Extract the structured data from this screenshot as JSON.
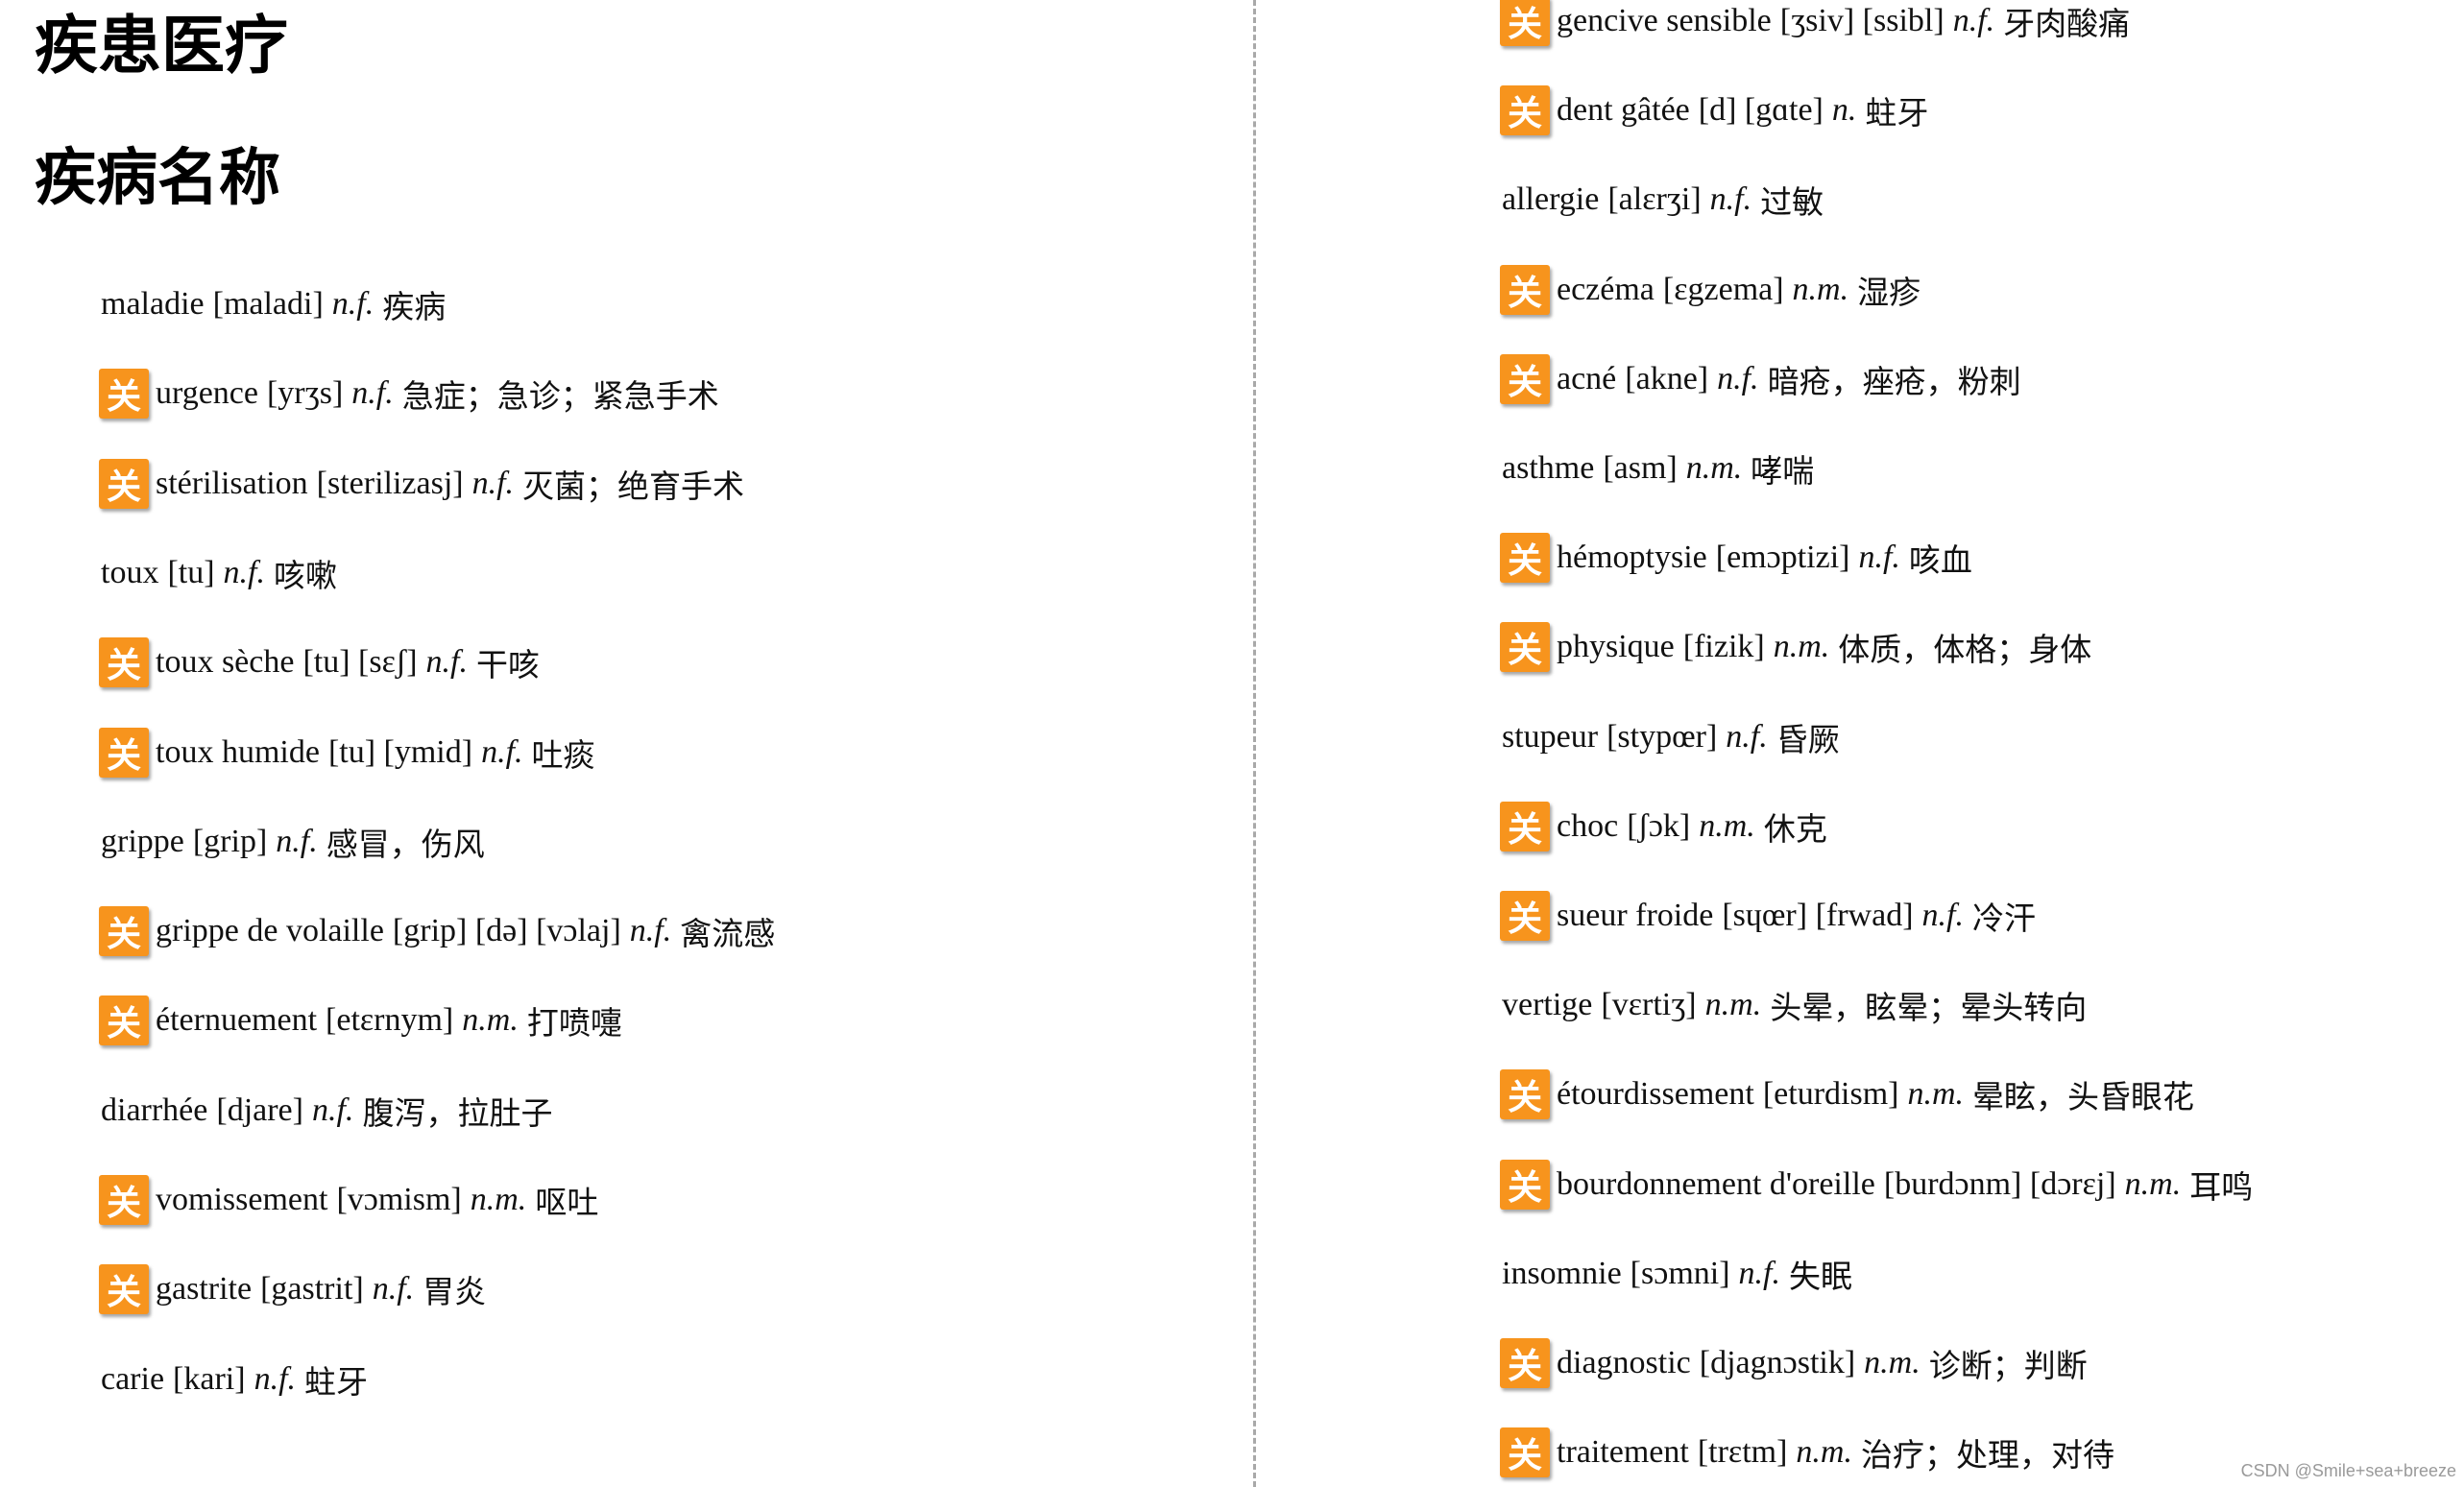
{
  "title": "疾患医疗",
  "section_title": "疾病名称",
  "badge_char": "关",
  "badge_color": "#f7941d",
  "watermark": "CSDN @Smile+sea+breeze",
  "left_entries": [
    {
      "word": "maladie",
      "ipa": "[maladi]",
      "pos": "n.f.",
      "zh": "疾病",
      "badge": false
    },
    {
      "word": "urgence",
      "ipa": "[yrʒs]",
      "pos": "n.f.",
      "zh": "急症；急诊；紧急手术",
      "badge": true
    },
    {
      "word": "stérilisation",
      "ipa": "[sterilizasj]",
      "pos": "n.f.",
      "zh": "灭菌；绝育手术",
      "badge": true
    },
    {
      "word": "toux",
      "ipa": "[tu]",
      "pos": "n.f.",
      "zh": "咳嗽",
      "badge": false
    },
    {
      "word": "toux sèche",
      "ipa": "[tu] [sɛʃ]",
      "pos": "n.f.",
      "zh": "干咳",
      "badge": true
    },
    {
      "word": "toux humide",
      "ipa": "[tu] [ymid]",
      "pos": "n.f.",
      "zh": "吐痰",
      "badge": true
    },
    {
      "word": "grippe",
      "ipa": "[grip]",
      "pos": "n.f.",
      "zh": "感冒，伤风",
      "badge": false
    },
    {
      "word": "grippe de volaille",
      "ipa": "[grip] [də] [vɔlaj]",
      "pos": "n.f.",
      "zh": "禽流感",
      "badge": true
    },
    {
      "word": "éternuement",
      "ipa": "[etɛrnym]",
      "pos": "n.m.",
      "zh": "打喷嚏",
      "badge": true
    },
    {
      "word": "diarrhée",
      "ipa": "[djare]",
      "pos": "n.f.",
      "zh": "腹泻，拉肚子",
      "badge": false
    },
    {
      "word": "vomissement",
      "ipa": "[vɔmism]",
      "pos": "n.m.",
      "zh": "呕吐",
      "badge": true
    },
    {
      "word": "gastrite",
      "ipa": "[gastrit]",
      "pos": "n.f.",
      "zh": "胃炎",
      "badge": true
    },
    {
      "word": "carie",
      "ipa": "[kari]",
      "pos": "n.f.",
      "zh": "蛀牙",
      "badge": false
    }
  ],
  "right_entries": [
    {
      "word": "gencive sensible",
      "ipa": "[ʒsiv] [ssibl]",
      "pos": "n.f.",
      "zh": "牙肉酸痛",
      "badge": true
    },
    {
      "word": "dent gâtée",
      "ipa": "[d] [gɑte]",
      "pos": "n.",
      "zh": "蛀牙",
      "badge": true
    },
    {
      "word": "allergie",
      "ipa": "[alɛrʒi]",
      "pos": "n.f.",
      "zh": "过敏",
      "badge": false
    },
    {
      "word": "eczéma",
      "ipa": "[ɛgzema]",
      "pos": "n.m.",
      "zh": "湿疹",
      "badge": true
    },
    {
      "word": "acné",
      "ipa": "[akne]",
      "pos": "n.f.",
      "zh": "暗疮，痤疮，粉刺",
      "badge": true
    },
    {
      "word": "asthme",
      "ipa": "[asm]",
      "pos": "n.m.",
      "zh": "哮喘",
      "badge": false
    },
    {
      "word": "hémoptysie",
      "ipa": "[emɔptizi]",
      "pos": "n.f.",
      "zh": "咳血",
      "badge": true
    },
    {
      "word": "physique",
      "ipa": "[fizik]",
      "pos": "n.m.",
      "zh": "体质，体格；身体",
      "badge": true
    },
    {
      "word": "stupeur",
      "ipa": "[stypœr]",
      "pos": "n.f.",
      "zh": "昏厥",
      "badge": false
    },
    {
      "word": "choc",
      "ipa": "[ʃɔk]",
      "pos": "n.m.",
      "zh": "休克",
      "badge": true
    },
    {
      "word": "sueur froide",
      "ipa": "[sɥœr] [frwad]",
      "pos": "n.f.",
      "zh": "冷汗",
      "badge": true
    },
    {
      "word": "vertige",
      "ipa": "[vɛrtiʒ]",
      "pos": "n.m.",
      "zh": "头晕，眩晕；晕头转向",
      "badge": false
    },
    {
      "word": "étourdissement",
      "ipa": "[eturdism]",
      "pos": "n.m.",
      "zh": "晕眩，头昏眼花",
      "badge": true
    },
    {
      "word": "bourdonnement d'oreille",
      "ipa": "[burdɔnm] [dɔrɛj]",
      "pos": "n.m.",
      "zh": "耳鸣",
      "badge": true
    },
    {
      "word": "insomnie",
      "ipa": "[sɔmni]",
      "pos": "n.f.",
      "zh": "失眠",
      "badge": false
    },
    {
      "word": "diagnostic",
      "ipa": "[djagnɔstik]",
      "pos": "n.m.",
      "zh": "诊断；判断",
      "badge": true
    },
    {
      "word": "traitement",
      "ipa": "[trɛtm]",
      "pos": "n.m.",
      "zh": "治疗；处理，对待",
      "badge": true
    }
  ]
}
